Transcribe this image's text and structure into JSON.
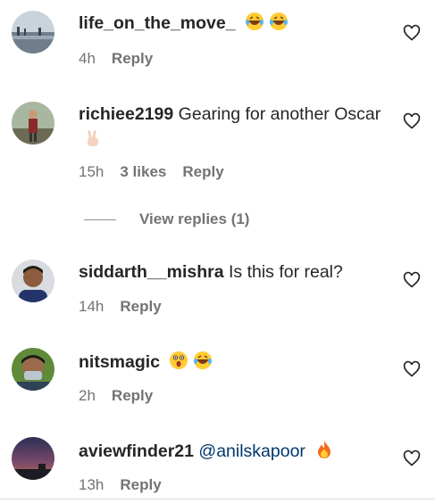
{
  "comments": [
    {
      "username": "life_on_the_move_",
      "text": "",
      "emojis": [
        "laughing-tears",
        "laughing-tears"
      ],
      "time": "4h",
      "likes": "",
      "reply": "Reply"
    },
    {
      "username": "richiee2199",
      "text": " Gearing for another Oscar",
      "emojis": [
        "victory-hand"
      ],
      "time": "15h",
      "likes": "3 likes",
      "reply": "Reply"
    },
    {
      "username": "siddarth__mishra",
      "text": " Is this for real?",
      "emojis": [],
      "time": "14h",
      "likes": "",
      "reply": "Reply"
    },
    {
      "username": "nitsmagic",
      "text": "",
      "emojis": [
        "astonished",
        "laughing-tears"
      ],
      "time": "2h",
      "likes": "",
      "reply": "Reply"
    },
    {
      "username": "aviewfinder21",
      "mention": "@anilskapoor",
      "text": "",
      "emojis": [
        "fire"
      ],
      "time": "13h",
      "likes": "",
      "reply": "Reply"
    }
  ],
  "view_replies": "View replies (1)",
  "colors": {
    "username": "#262626",
    "meta": "#737373",
    "mention": "#00376b"
  }
}
